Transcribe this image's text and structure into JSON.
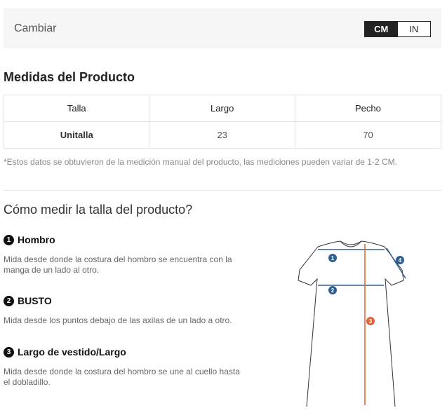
{
  "unit_bar": {
    "label": "Cambiar",
    "options": [
      "CM",
      "IN"
    ],
    "selected": "CM"
  },
  "measurements": {
    "title": "Medidas del Producto",
    "columns": [
      "Talla",
      "Largo",
      "Pecho"
    ],
    "rows": [
      [
        "Unitalla",
        "23",
        "70"
      ]
    ],
    "note": "*Estos datos se obtuvieron de la medición manual del producto, las mediciones pueden variar de 1-2 CM."
  },
  "how_to": {
    "title": "Cómo medir la talla del producto?",
    "items": [
      {
        "num": "1",
        "title": "Hombro",
        "desc": "Mida desde donde la costura del hombro se encuentra con la manga de un lado al otro."
      },
      {
        "num": "2",
        "title": "BUSTO",
        "desc": "Mida desde los puntos debajo de las axilas de un lado a otro."
      },
      {
        "num": "3",
        "title": "Largo de vestido/Largo",
        "desc": "Mida desde donde la costura del hombro se une al cuello hasta el dobladillo."
      }
    ]
  },
  "diagram": {
    "markers": [
      "1",
      "2",
      "3",
      "4"
    ],
    "colors": {
      "blue": "#2f5f93",
      "orange": "#e0643a",
      "outline": "#333333"
    }
  }
}
